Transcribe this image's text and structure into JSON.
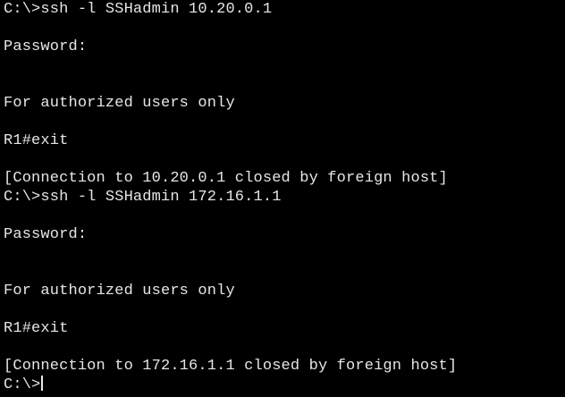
{
  "terminal": {
    "lines": [
      "C:\\>ssh -l SSHadmin 10.20.0.1",
      "",
      "Password:",
      "",
      "",
      "For authorized users only",
      "",
      "R1#exit",
      "",
      "[Connection to 10.20.0.1 closed by foreign host]",
      "C:\\>ssh -l SSHadmin 172.16.1.1",
      "",
      "Password:",
      "",
      "",
      "For authorized users only",
      "",
      "R1#exit",
      "",
      "[Connection to 172.16.1.1 closed by foreign host]"
    ],
    "prompt": "C:\\>"
  },
  "colors": {
    "background": "#000000",
    "foreground": "#e6e6e6"
  }
}
